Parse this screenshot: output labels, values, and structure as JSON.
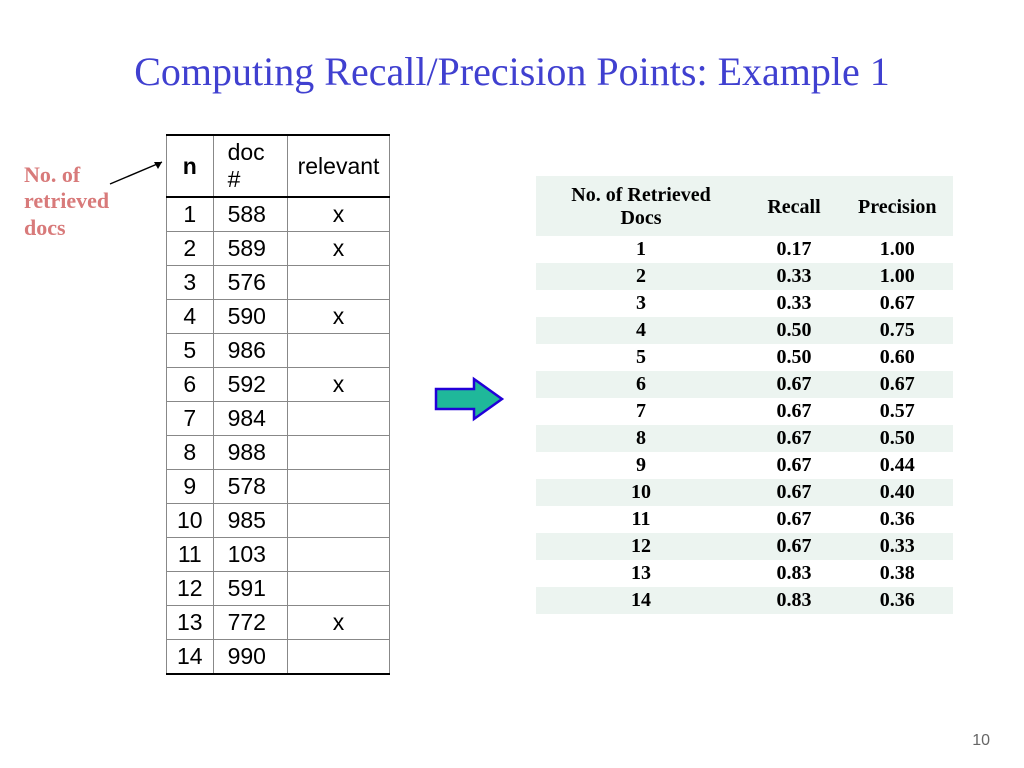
{
  "title": "Computing Recall/Precision Points: Example 1",
  "annotation": "No. of\nretrieved\ndocs",
  "left_table": {
    "headers": {
      "n": "n",
      "doc": "doc #",
      "relevant": "relevant"
    },
    "rows": [
      {
        "n": "1",
        "doc": "588",
        "rel": "x"
      },
      {
        "n": "2",
        "doc": "589",
        "rel": "x"
      },
      {
        "n": "3",
        "doc": "576",
        "rel": ""
      },
      {
        "n": "4",
        "doc": "590",
        "rel": "x"
      },
      {
        "n": "5",
        "doc": "986",
        "rel": ""
      },
      {
        "n": "6",
        "doc": "592",
        "rel": "x"
      },
      {
        "n": "7",
        "doc": "984",
        "rel": ""
      },
      {
        "n": "8",
        "doc": "988",
        "rel": ""
      },
      {
        "n": "9",
        "doc": "578",
        "rel": ""
      },
      {
        "n": "10",
        "doc": "985",
        "rel": ""
      },
      {
        "n": "11",
        "doc": "103",
        "rel": ""
      },
      {
        "n": "12",
        "doc": "591",
        "rel": ""
      },
      {
        "n": "13",
        "doc": "772",
        "rel": "x"
      },
      {
        "n": "14",
        "doc": "990",
        "rel": ""
      }
    ]
  },
  "right_table": {
    "headers": {
      "docs": "No. of Retrieved Docs",
      "recall": "Recall",
      "precision": "Precision"
    },
    "rows": [
      {
        "docs": "1",
        "recall": "0.17",
        "precision": "1.00"
      },
      {
        "docs": "2",
        "recall": "0.33",
        "precision": "1.00"
      },
      {
        "docs": "3",
        "recall": "0.33",
        "precision": "0.67"
      },
      {
        "docs": "4",
        "recall": "0.50",
        "precision": "0.75"
      },
      {
        "docs": "5",
        "recall": "0.50",
        "precision": "0.60"
      },
      {
        "docs": "6",
        "recall": "0.67",
        "precision": "0.67"
      },
      {
        "docs": "7",
        "recall": "0.67",
        "precision": "0.57"
      },
      {
        "docs": "8",
        "recall": "0.67",
        "precision": "0.50"
      },
      {
        "docs": "9",
        "recall": "0.67",
        "precision": "0.44"
      },
      {
        "docs": "10",
        "recall": "0.67",
        "precision": "0.40"
      },
      {
        "docs": "11",
        "recall": "0.67",
        "precision": "0.36"
      },
      {
        "docs": "12",
        "recall": "0.67",
        "precision": "0.33"
      },
      {
        "docs": "13",
        "recall": "0.83",
        "precision": "0.38"
      },
      {
        "docs": "14",
        "recall": "0.83",
        "precision": "0.36"
      }
    ]
  },
  "page_number": "10",
  "chart_data": [
    {
      "type": "table",
      "title": "Retrieved documents with relevance marks",
      "columns": [
        "n",
        "doc #",
        "relevant"
      ],
      "rows": [
        [
          1,
          588,
          "x"
        ],
        [
          2,
          589,
          "x"
        ],
        [
          3,
          576,
          ""
        ],
        [
          4,
          590,
          "x"
        ],
        [
          5,
          986,
          ""
        ],
        [
          6,
          592,
          "x"
        ],
        [
          7,
          984,
          ""
        ],
        [
          8,
          988,
          ""
        ],
        [
          9,
          578,
          ""
        ],
        [
          10,
          985,
          ""
        ],
        [
          11,
          103,
          ""
        ],
        [
          12,
          591,
          ""
        ],
        [
          13,
          772,
          "x"
        ],
        [
          14,
          990,
          ""
        ]
      ]
    },
    {
      "type": "table",
      "title": "Recall/Precision at each cutoff",
      "columns": [
        "No. of Retrieved Docs",
        "Recall",
        "Precision"
      ],
      "rows": [
        [
          1,
          0.17,
          1.0
        ],
        [
          2,
          0.33,
          1.0
        ],
        [
          3,
          0.33,
          0.67
        ],
        [
          4,
          0.5,
          0.75
        ],
        [
          5,
          0.5,
          0.6
        ],
        [
          6,
          0.67,
          0.67
        ],
        [
          7,
          0.67,
          0.57
        ],
        [
          8,
          0.67,
          0.5
        ],
        [
          9,
          0.67,
          0.44
        ],
        [
          10,
          0.67,
          0.4
        ],
        [
          11,
          0.67,
          0.36
        ],
        [
          12,
          0.67,
          0.33
        ],
        [
          13,
          0.83,
          0.38
        ],
        [
          14,
          0.83,
          0.36
        ]
      ]
    }
  ]
}
